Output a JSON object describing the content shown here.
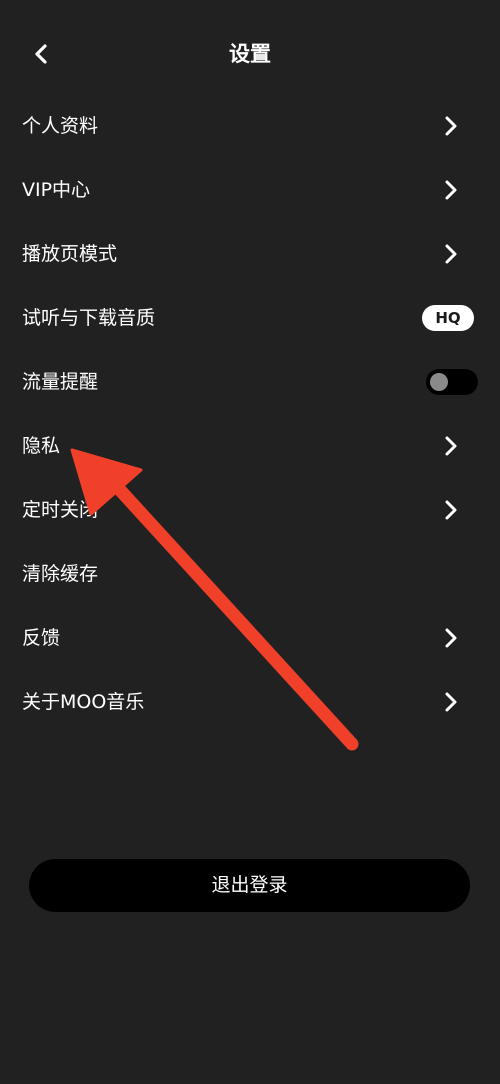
{
  "header": {
    "title": "设置",
    "back_icon": "chevron-left-icon"
  },
  "settings": [
    {
      "label": "个人资料",
      "trailing": "chevron"
    },
    {
      "label": "VIP中心",
      "trailing": "chevron"
    },
    {
      "label": "播放页模式",
      "trailing": "chevron"
    },
    {
      "label": "试听与下载音质",
      "trailing": "badge",
      "badge": "HQ"
    },
    {
      "label": "流量提醒",
      "trailing": "toggle",
      "toggle_on": false
    },
    {
      "label": "隐私",
      "trailing": "chevron"
    },
    {
      "label": "定时关闭",
      "trailing": "chevron"
    },
    {
      "label": "清除缓存",
      "trailing": "none"
    },
    {
      "label": "反馈",
      "trailing": "chevron"
    },
    {
      "label": "关于MOO音乐",
      "trailing": "chevron"
    }
  ],
  "logout": {
    "label": "退出登录"
  },
  "colors": {
    "background": "#212121",
    "text": "#ffffff",
    "button_bg": "#000000",
    "annotation_arrow": "#f0402a"
  }
}
